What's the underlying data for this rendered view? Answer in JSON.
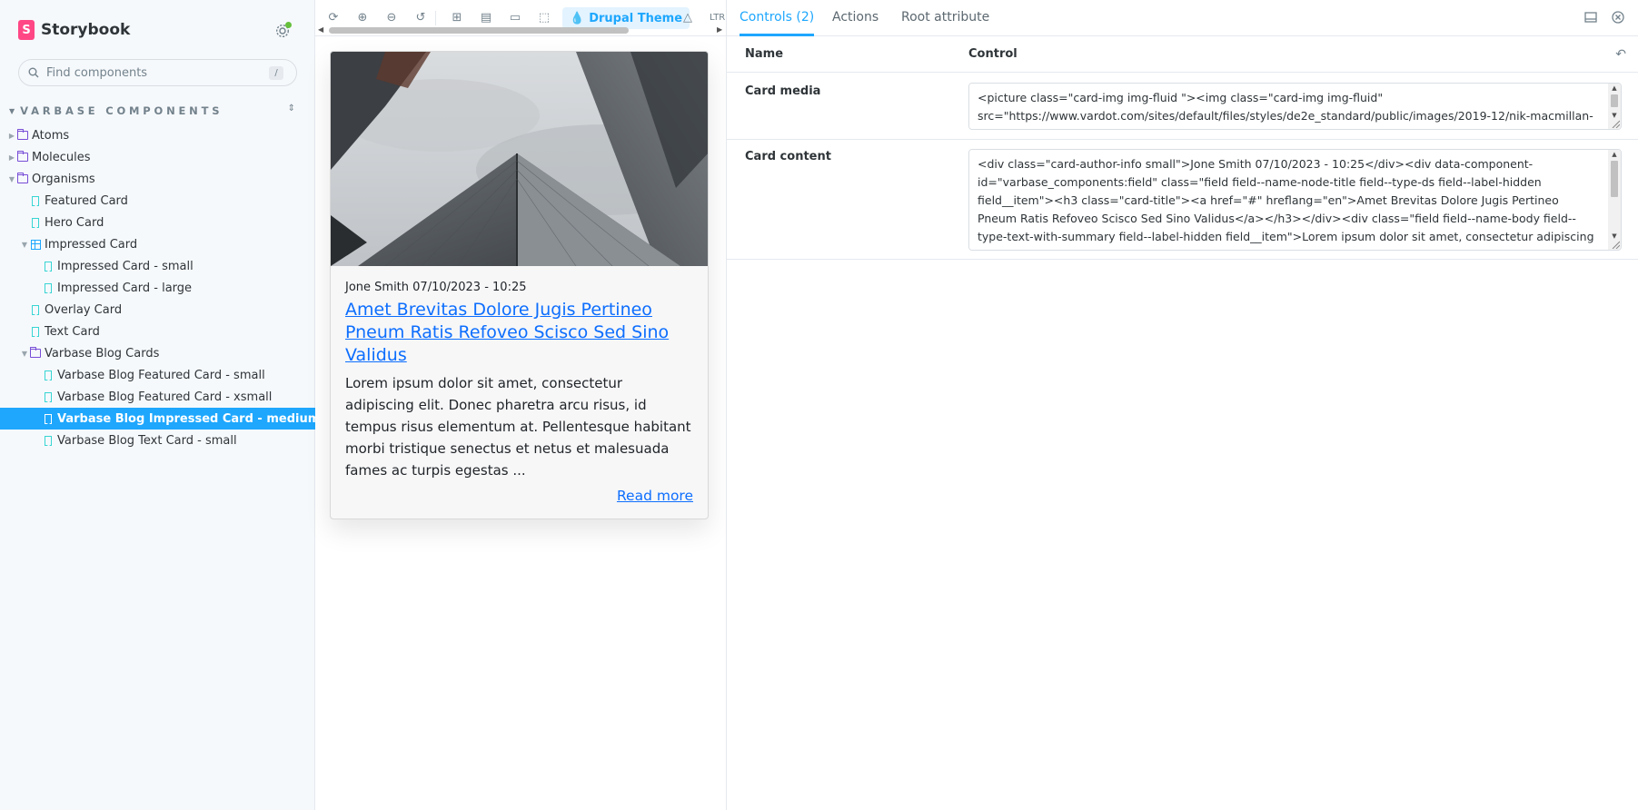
{
  "app": {
    "name": "Storybook",
    "logo_letter": "S"
  },
  "search": {
    "placeholder": "Find components",
    "shortcut": "/"
  },
  "sidebar": {
    "section_title": "VARBASE COMPONENTS",
    "items": [
      {
        "label": "Atoms",
        "type": "folder",
        "depth": 0,
        "expanded": false
      },
      {
        "label": "Molecules",
        "type": "folder",
        "depth": 0,
        "expanded": false
      },
      {
        "label": "Organisms",
        "type": "folder",
        "depth": 0,
        "expanded": true
      },
      {
        "label": "Featured Card",
        "type": "story",
        "depth": 1
      },
      {
        "label": "Hero Card",
        "type": "story",
        "depth": 1
      },
      {
        "label": "Impressed Card",
        "type": "component",
        "depth": 1,
        "expanded": true
      },
      {
        "label": "Impressed Card - small",
        "type": "story",
        "depth": 2
      },
      {
        "label": "Impressed Card - large",
        "type": "story",
        "depth": 2
      },
      {
        "label": "Overlay Card",
        "type": "story",
        "depth": 1
      },
      {
        "label": "Text Card",
        "type": "story",
        "depth": 1
      },
      {
        "label": "Varbase Blog Cards",
        "type": "folder",
        "depth": 1,
        "expanded": true
      },
      {
        "label": "Varbase Blog Featured Card - small",
        "type": "story",
        "depth": 2
      },
      {
        "label": "Varbase Blog Featured Card - xsmall",
        "type": "story",
        "depth": 2
      },
      {
        "label": "Varbase Blog Impressed Card - medium",
        "type": "story",
        "depth": 2,
        "selected": true
      },
      {
        "label": "Varbase Blog Text Card - small",
        "type": "story",
        "depth": 2
      }
    ]
  },
  "toolbar": {
    "theme_label": "Drupal Theme",
    "direction_label": "LTR"
  },
  "card": {
    "author_info": "Jone Smith 07/10/2023 - 10:25",
    "title": "Amet Brevitas Dolore Jugis Pertineo Pneum Ratis Refoveo Scisco Sed Sino Validus",
    "body": "Lorem ipsum dolor sit amet, consectetur adipiscing elit. Donec pharetra arcu risus, id tempus risus elementum at. Pellentesque habitant morbi tristique senectus et netus et malesuada fames ac turpis egestas ...",
    "read_more": "Read more"
  },
  "panel": {
    "tabs": [
      "Controls (2)",
      "Actions",
      "Root attribute"
    ],
    "active_tab": 0,
    "columns": {
      "name": "Name",
      "control": "Control"
    },
    "controls": [
      {
        "name": "Card media",
        "value": "<picture class=\"card-img img-fluid \"><img class=\"card-img img-fluid\" src=\"https://www.vardot.com/sites/default/files/styles/de2e_standard/public/images/2019-12/nik-macmillan-unsplash.jpg\" alt=\"\" /></picture>"
      },
      {
        "name": "Card content",
        "value": "<div class=\"card-author-info small\">Jone Smith 07/10/2023 - 10:25</div><div data-component-id=\"varbase_components:field\" class=\"field field--name-node-title field--type-ds field--label-hidden field__item\"><h3 class=\"card-title\"><a href=\"#\" hreflang=\"en\">Amet Brevitas Dolore Jugis Pertineo Pneum Ratis Refoveo Scisco Sed Sino Validus</a></h3></div><div class=\"field field--name-body field--type-text-with-summary field--label-hidden field__item\">Lorem ipsum dolor sit amet, consectetur adipiscing elit. Donec pharetra arcu risus, id tempus risus elementum at. Pellentesque habitant morbi tristique senectus et netus et malesuada fames ac turpis egestas ...</div>"
      }
    ]
  },
  "colors": {
    "accent": "#1ea7fd",
    "brand": "#ff4785",
    "folder": "#774dd7",
    "story": "#37d5d3",
    "link": "#0d6efd"
  }
}
